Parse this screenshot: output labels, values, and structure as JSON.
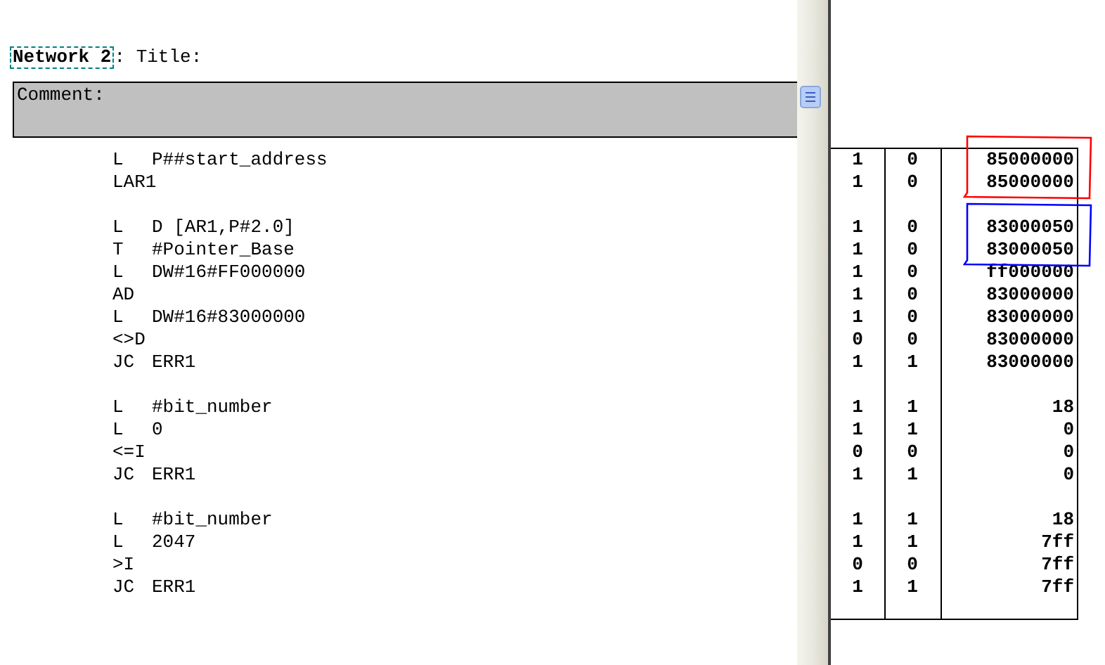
{
  "network": {
    "label": "Network 2",
    "title": ": Title:"
  },
  "comment": {
    "label": "Comment:"
  },
  "groups": [
    {
      "rows": [
        {
          "instruction": "L",
          "operand": "P##start_address",
          "col_1": "1",
          "col_2": "0",
          "col_3": "85000000",
          "color": "#ff0000"
        },
        {
          "instruction": "LAR1",
          "col_1": "1",
          "col_2": "0",
          "col_3": "85000000",
          "color": "#ff0000"
        }
      ]
    },
    {
      "rows": [
        {
          "instruction": "L",
          "operand": "D [AR1,P#2.0]",
          "col_1": "1",
          "col_2": "0",
          "col_3": "83000050",
          "color": "#0000ff"
        },
        {
          "instruction": "T",
          "operand": "#Pointer_Base",
          "col_1": "1",
          "col_2": "0",
          "col_3": "83000050",
          "color": "#0000ff"
        },
        {
          "instruction": "L",
          "operand": "DW#16#FF000000",
          "col_1": "1",
          "col_2": "0",
          "col_3": "ff000000"
        },
        {
          "instruction": "AD",
          "col_1": "1",
          "col_2": "0",
          "col_3": "83000000"
        },
        {
          "instruction": "L",
          "operand": "DW#16#83000000",
          "col_1": "1",
          "col_2": "0",
          "col_3": "83000000"
        },
        {
          "instruction": "<>D",
          "col_1": "0",
          "col_2": "0",
          "col_3": "83000000"
        },
        {
          "instruction": "JC",
          "operand": "ERR1",
          "col_1": "1",
          "col_2": "1",
          "col_3": "83000000"
        }
      ]
    },
    {
      "rows": [
        {
          "instruction": "L",
          "operand": "#bit_number",
          "col_1": "1",
          "col_2": "1",
          "col_3": "18"
        },
        {
          "instruction": "L",
          "operand": "0",
          "col_1": "1",
          "col_2": "1",
          "col_3": "0"
        },
        {
          "instruction": "<=I",
          "col_1": "0",
          "col_2": "0",
          "col_3": "0"
        },
        {
          "instruction": "JC",
          "operand": "ERR1",
          "col_1": "1",
          "col_2": "1",
          "col_3": "0"
        }
      ]
    },
    {
      "rows": [
        {
          "instruction": "L",
          "operand": "#bit_number",
          "col_1": "1",
          "col_2": "1",
          "col_3": "18"
        },
        {
          "instruction": "L",
          "operand": "2047",
          "col_1": "1",
          "col_2": "1",
          "col_3": "7ff"
        },
        {
          "instruction": ">I",
          "col_1": "0",
          "col_2": "0",
          "col_3": "7ff"
        },
        {
          "instruction": "JC",
          "operand": "ERR1",
          "col_1": "1",
          "col_2": "1",
          "col_3": "7ff"
        }
      ]
    }
  ]
}
